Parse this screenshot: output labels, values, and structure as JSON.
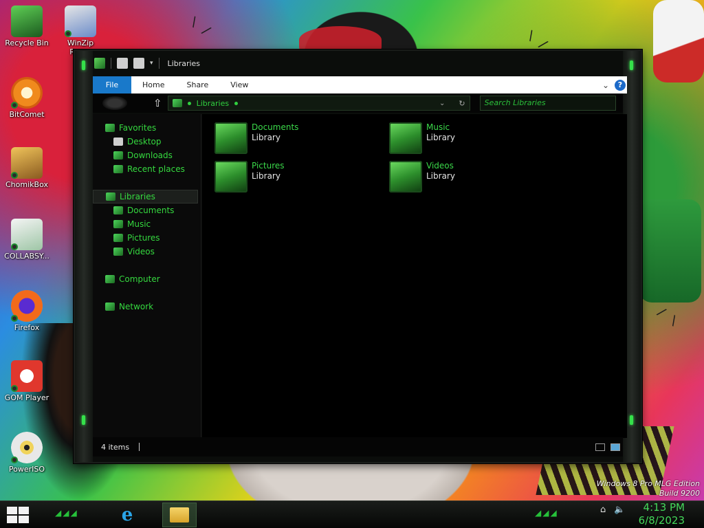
{
  "desktop": {
    "icons": [
      {
        "label": "Recycle Bin"
      },
      {
        "label": "WinZip\nReg..."
      },
      {
        "label": "BitComet"
      },
      {
        "label": "ChomikBox"
      },
      {
        "label": "COLLABSY..."
      },
      {
        "label": "Firefox"
      },
      {
        "label": "GOM Player"
      },
      {
        "label": "PowerISO"
      }
    ],
    "watermark": {
      "line1": "Windows 8 Pro MLG Edition",
      "line2": "Build 9200"
    }
  },
  "window": {
    "title": "Libraries",
    "ribbon": {
      "tabs": [
        "File",
        "Home",
        "Share",
        "View"
      ],
      "help": "?"
    },
    "address": {
      "path": "Libraries",
      "search_placeholder": "Search Libraries"
    },
    "nav": {
      "favorites": "Favorites",
      "favorites_items": [
        "Desktop",
        "Downloads",
        "Recent places"
      ],
      "libraries": "Libraries",
      "libraries_items": [
        "Documents",
        "Music",
        "Pictures",
        "Videos"
      ],
      "computer": "Computer",
      "network": "Network"
    },
    "content": {
      "items": [
        {
          "name": "Documents",
          "type": "Library"
        },
        {
          "name": "Music",
          "type": "Library"
        },
        {
          "name": "Pictures",
          "type": "Library"
        },
        {
          "name": "Videos",
          "type": "Library"
        }
      ]
    },
    "status": {
      "count": "4 items"
    }
  },
  "taskbar": {
    "time": "4:13 PM",
    "date": "6/8/2023"
  },
  "colors": {
    "accent_green": "#35d93f",
    "file_tab_blue": "#1979ca",
    "window_bg": "#000000"
  }
}
